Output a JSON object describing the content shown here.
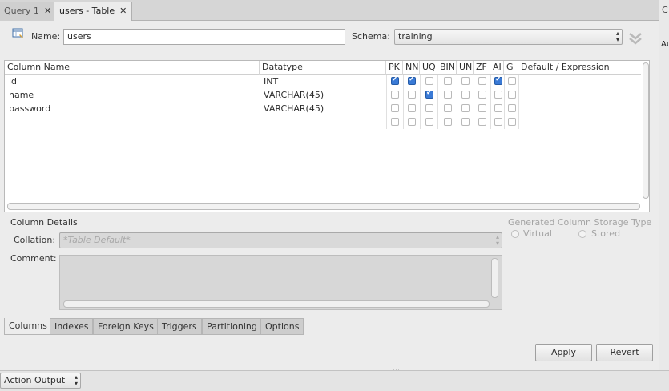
{
  "tabs": [
    {
      "label": "Query 1",
      "close": "✕"
    },
    {
      "label": "users - Table",
      "close": "✕"
    }
  ],
  "right_strip": {
    "top": "C",
    "mid": "Au"
  },
  "name": {
    "label": "Name:",
    "value": "users"
  },
  "schema": {
    "label": "Schema:",
    "value": "training"
  },
  "grid": {
    "headers": [
      "Column Name",
      "Datatype",
      "PK",
      "NN",
      "UQ",
      "BIN",
      "UN",
      "ZF",
      "AI",
      "G",
      "Default / Expression"
    ],
    "rows": [
      {
        "name": "id",
        "type": "INT",
        "flags": [
          true,
          true,
          false,
          false,
          false,
          false,
          true,
          false
        ]
      },
      {
        "name": "name",
        "type": "VARCHAR(45)",
        "flags": [
          false,
          false,
          true,
          false,
          false,
          false,
          false,
          false
        ]
      },
      {
        "name": "password",
        "type": "VARCHAR(45)",
        "flags": [
          false,
          false,
          false,
          false,
          false,
          false,
          false,
          false
        ]
      },
      {
        "name": "",
        "type": "",
        "flags": [
          false,
          false,
          false,
          false,
          false,
          false,
          false,
          false
        ]
      }
    ]
  },
  "details": {
    "title": "Column Details",
    "collation_label": "Collation:",
    "collation_value": "*Table Default*",
    "comment_label": "Comment:",
    "storage_title": "Generated Column Storage Type",
    "virtual": "Virtual",
    "stored": "Stored"
  },
  "bottom_tabs": [
    "Columns",
    "Indexes",
    "Foreign Keys",
    "Triggers",
    "Partitioning",
    "Options"
  ],
  "buttons": {
    "apply": "Apply",
    "revert": "Revert"
  },
  "footer": {
    "action_output": "Action Output"
  }
}
